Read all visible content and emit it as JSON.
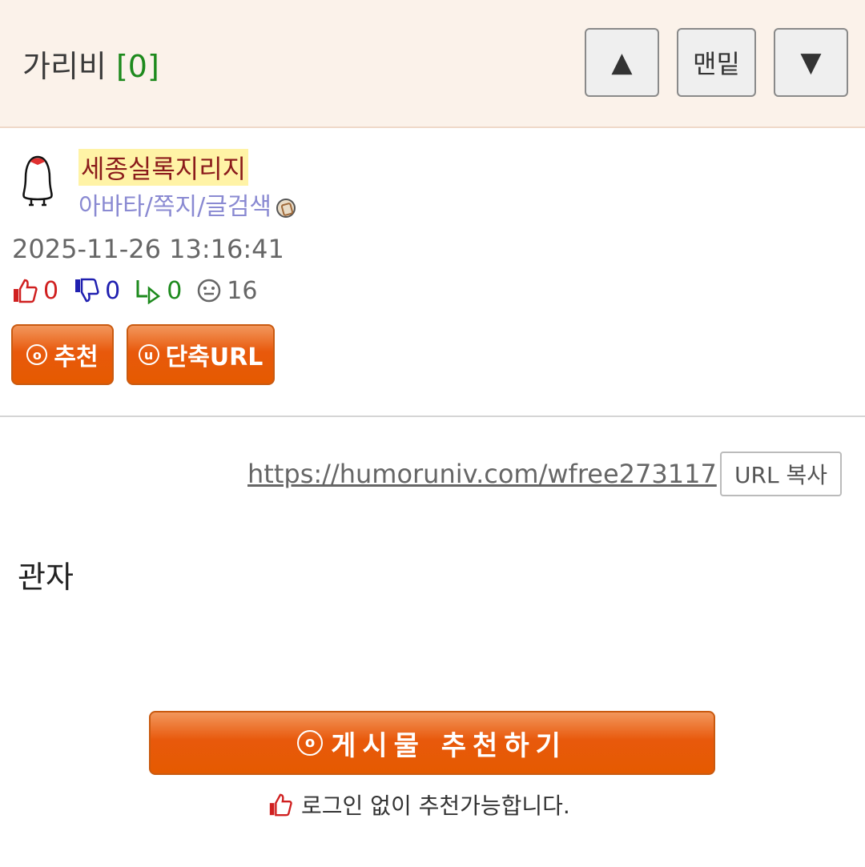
{
  "header": {
    "title": "가리비",
    "comment_count": "[0]",
    "nav_up_label": "▲",
    "nav_bottom_label": "맨밑",
    "nav_down_label": "▼"
  },
  "author": {
    "nickname": "세종실록지리지",
    "links": "아바타/쪽지/글검색",
    "avatar_icon": "penguin-icon"
  },
  "post": {
    "datetime": "2025-11-26 13:16:41",
    "stats": {
      "upvotes": "0",
      "downvotes": "0",
      "replies": "0",
      "views": "16"
    },
    "recommend_circle": "o",
    "recommend_label": "추천",
    "shorturl_circle": "u",
    "shorturl_label": "단축URL",
    "url": "https://humoruniv.com/wfree273117",
    "copy_label": "URL 복사",
    "content": "관자"
  },
  "footer": {
    "recommend_big_circle": "o",
    "recommend_big_label": "게시물 추천하기",
    "note": "로그인 없이 추천가능합니다."
  },
  "colors": {
    "header_bg": "#fbf2ea",
    "button_orange": "#e8590c",
    "comment_count": "#1d8a1d",
    "nickname_bg": "#fff3a6",
    "upvote": "#d02020",
    "downvote": "#2020b0",
    "reply": "#1d8a1d"
  }
}
